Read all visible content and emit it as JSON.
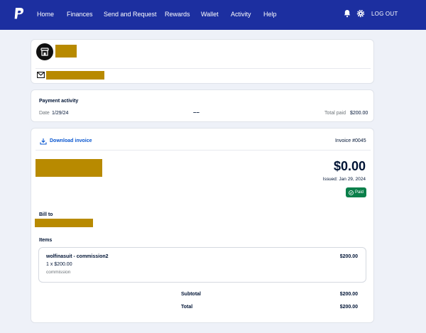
{
  "nav": {
    "items": [
      "Home",
      "Finances",
      "Send and Request",
      "Rewards",
      "Wallet",
      "Activity",
      "Help"
    ],
    "logout": "LOG OUT"
  },
  "payment_activity": {
    "title": "Payment activity",
    "date_label": "Date",
    "date_value": "1/29/24",
    "middle": "––",
    "total_label": "Total paid",
    "total_value": "$200.00"
  },
  "invoice": {
    "download_label": "Download invoice",
    "number": "Invoice #0045",
    "amount": "$0.00",
    "issued": "Issued: Jan 29, 2024",
    "status": "Paid",
    "bill_to": "Bill to",
    "items_title": "Items",
    "item": {
      "name": "wolfinasuit - commission2",
      "qty": "1 x $200.00",
      "desc": "commission",
      "price": "$200.00"
    },
    "subtotal_label": "Subtotal",
    "subtotal_value": "$200.00",
    "total_label": "Total",
    "total_value": "$200.00"
  },
  "colors": {
    "nav_bg": "#1c2fa0",
    "page_bg": "#eef1f8",
    "link": "#0a57d0",
    "paid": "#0a7f4a",
    "redaction": "#b88a00"
  }
}
